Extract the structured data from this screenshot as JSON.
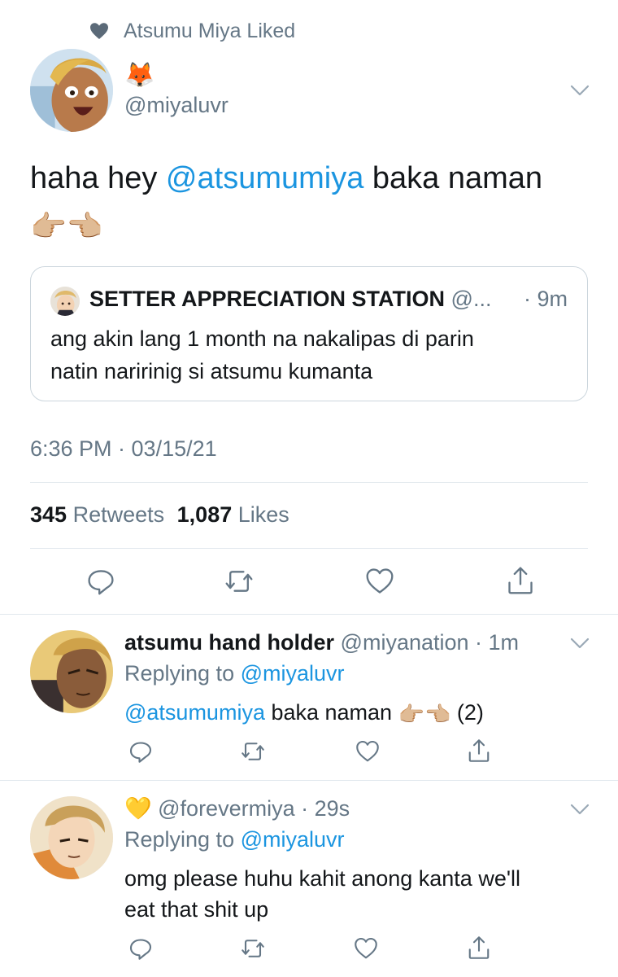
{
  "social_context": {
    "text": "Atsumu Miya Liked",
    "icon": "heart-icon"
  },
  "main_tweet": {
    "display_name": "🦊",
    "handle": "@miyaluvr",
    "text_before": "haha hey ",
    "mention": "@atsumumiya",
    "text_after": " baka naman",
    "emoji_line": "👉🏼👈🏼",
    "quoted": {
      "display_name": "SETTER APPRECIATION STATION",
      "handle_trunc": "@...",
      "time": "· 9m",
      "text_line1": "ang akin lang 1 month na nakalipas di parin",
      "text_line2": "natin naririnig si atsumu kumanta"
    },
    "timestamp": "6:36 PM · 03/15/21",
    "retweets_count": "345",
    "retweets_label": "Retweets",
    "likes_count": "1,087",
    "likes_label": "Likes"
  },
  "replies": [
    {
      "display_name": "atsumu hand holder",
      "handle_time": "@miyanation · 1m",
      "replying_prefix": "Replying to",
      "replying_to": "@miyaluvr",
      "mention": "@atsumumiya",
      "text": " baka naman",
      "suffix": " (2)"
    },
    {
      "display_name": "💛",
      "handle_time": "@forevermiya · 29s",
      "replying_prefix": "Replying to",
      "replying_to": "@miyaluvr",
      "text_line1": "omg please huhu kahit anong kanta we'll",
      "text_line2": "eat that shit up"
    }
  ],
  "colors": {
    "link": "#1b95e0",
    "muted": "#657786",
    "divider": "#e1e8ed",
    "text": "#14171a"
  }
}
